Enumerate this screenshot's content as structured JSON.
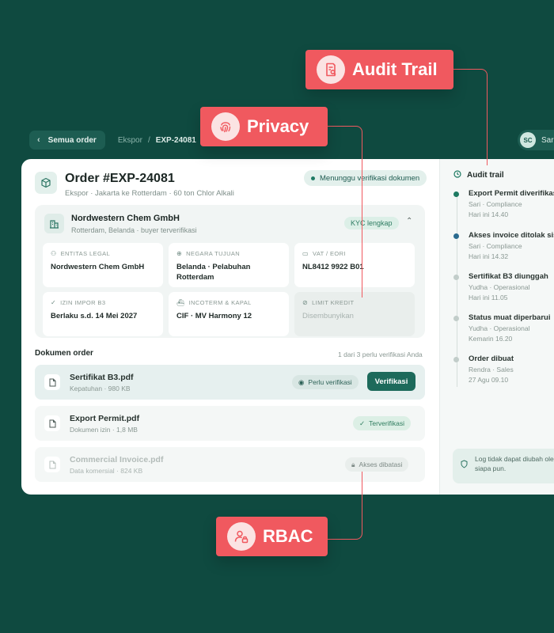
{
  "nav": {
    "back_label": "Semua order",
    "crumb_1": "Ekspor",
    "crumb_sep": "/",
    "crumb_2": "EXP-24081",
    "user_initials": "SC",
    "user_name": "Sari"
  },
  "order": {
    "title": "Order #EXP-24081",
    "subtitle": "Ekspor · Jakarta ke Rotterdam · 60 ton Chlor Alkali",
    "status": "Menunggu verifikasi dokumen"
  },
  "company": {
    "name": "Nordwestern Chem GmbH",
    "sub": "Rotterdam, Belanda · buyer terverifikasi",
    "kyc": "KYC lengkap",
    "fields": [
      {
        "label": "ENTITAS LEGAL",
        "value": "Nordwestern Chem GmbH",
        "icon": "person-icon"
      },
      {
        "label": "NEGARA TUJUAN",
        "value": "Belanda · Pelabuhan Rotterdam",
        "icon": "globe-icon"
      },
      {
        "label": "VAT / EORI",
        "value": "NL8412 9922 B01",
        "icon": "id-card-icon"
      },
      {
        "label": "IZIN IMPOR B3",
        "value": "Berlaku s.d. 14 Mei 2027",
        "icon": "check-icon"
      },
      {
        "label": "INCOTERM & KAPAL",
        "value": "CIF · MV Harmony 12",
        "icon": "ship-icon"
      },
      {
        "label": "LIMIT KREDIT",
        "value": "Disembunyikan",
        "icon": "eye-off-icon"
      }
    ]
  },
  "documents": {
    "heading": "Dokumen order",
    "count_text": "1 dari 3 perlu verifikasi Anda",
    "items": [
      {
        "name": "Sertifikat B3.pdf",
        "meta": "Kepatuhan · 980 KB",
        "status": "Perlu verifikasi",
        "action": "Verifikasi"
      },
      {
        "name": "Export Permit.pdf",
        "meta": "Dokumen izin · 1,8 MB",
        "status": "Terverifikasi"
      },
      {
        "name": "Commercial Invoice.pdf",
        "meta": "Data komersial · 824 KB",
        "status": "Akses dibatasi"
      }
    ]
  },
  "audit": {
    "title": "Audit trail",
    "events": [
      {
        "title": "Export Permit diverifikasi",
        "who": "Sari · Compliance",
        "when": "Hari ini 14.40",
        "dot_color": "#1d7a62"
      },
      {
        "title": "Akses invoice ditolak sistem",
        "who": "Sari · Compliance",
        "when": "Hari ini 14.32",
        "dot_color": "#2a6b8f"
      },
      {
        "title": "Sertifikat B3 diunggah",
        "who": "Yudha · Operasional",
        "when": "Hari ini 11.05",
        "dot_color": "#c2cdca"
      },
      {
        "title": "Status muat diperbarui",
        "who": "Yudha · Operasional",
        "when": "Kemarin 16.20",
        "dot_color": "#c2cdca"
      },
      {
        "title": "Order dibuat",
        "who": "Rendra · Sales",
        "when": "27 Agu 09.10",
        "dot_color": "#c2cdca"
      }
    ],
    "note": "Log tidak dapat diubah oleh siapa pun."
  },
  "callouts": {
    "audit": "Audit Trail",
    "privacy": "Privacy",
    "rbac": "RBAC"
  },
  "colors": {
    "background": "#0f4a40",
    "accent": "#1d6a5b",
    "callout": "#f0595f"
  }
}
